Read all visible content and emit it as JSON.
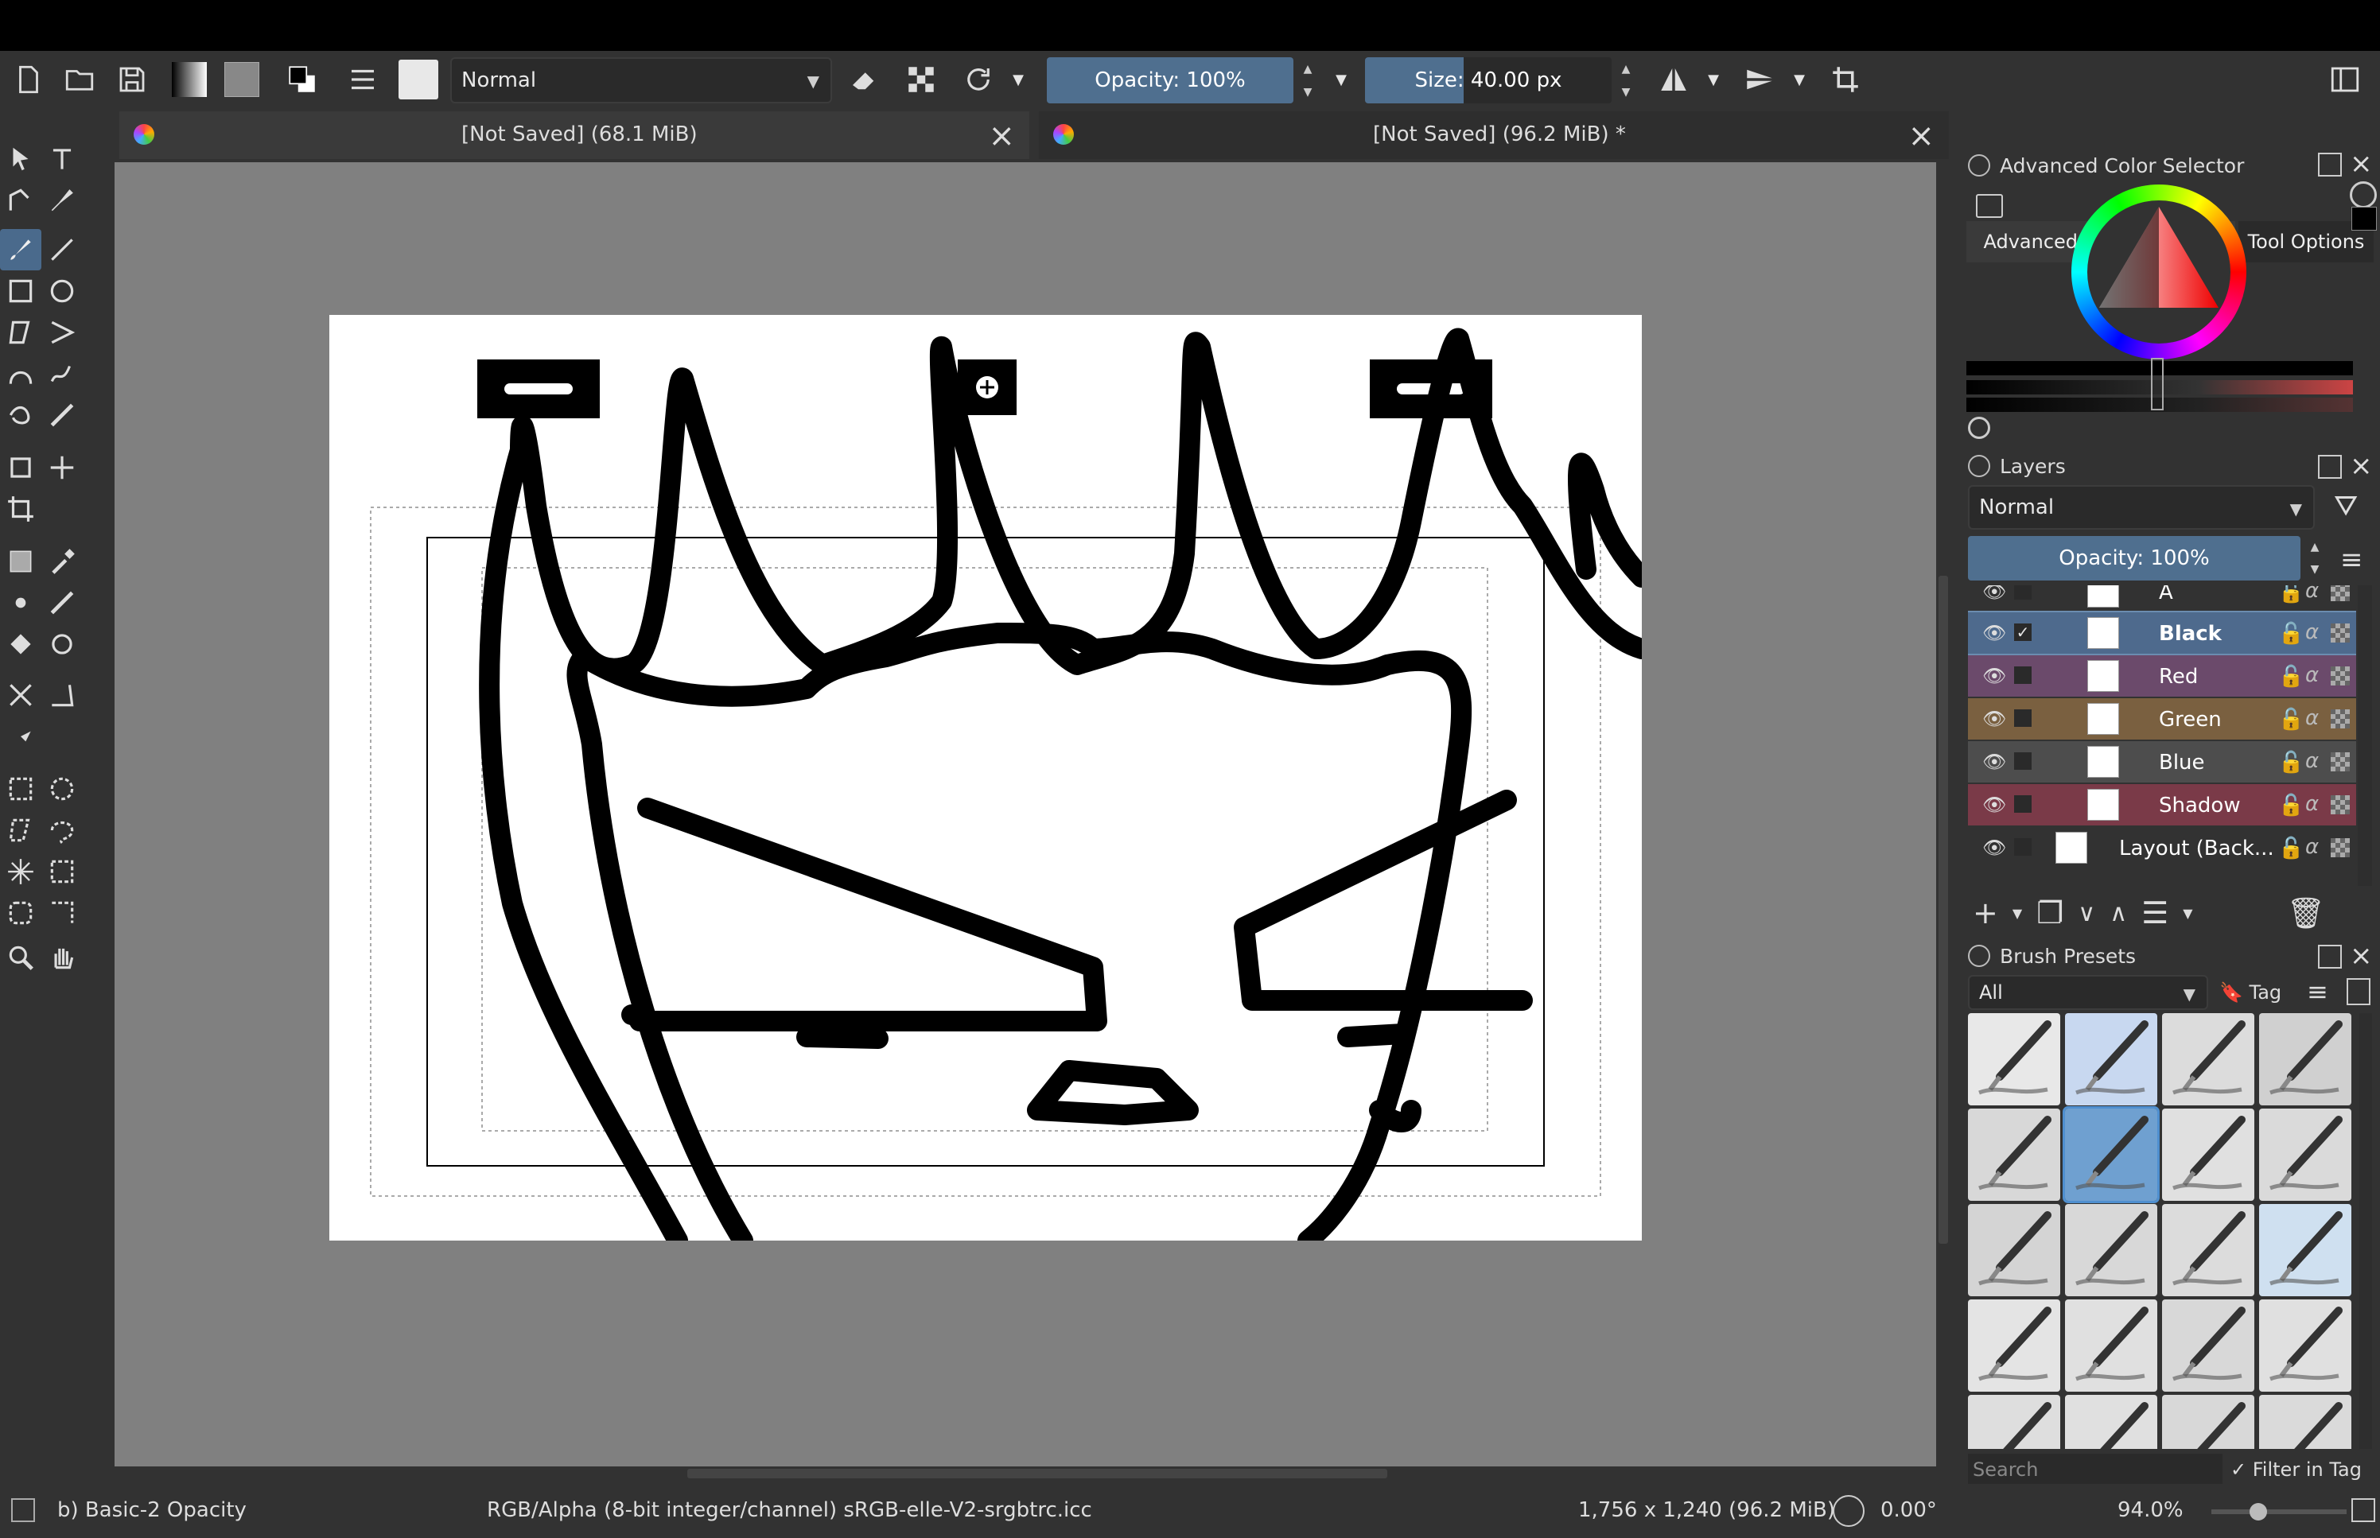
{
  "toolbar": {
    "blend_mode": "Normal",
    "opacity": "Opacity: 100%",
    "opacity_fraction": 1.0,
    "size": "Size: 40.00 px",
    "size_fraction": 0.4
  },
  "tabs": [
    {
      "label": "[Not Saved]  (68.1 MiB)"
    },
    {
      "label": "[Not Saved]  (96.2 MiB) *"
    }
  ],
  "dock": {
    "tab_color": "Advanced Color Selector",
    "tab_options": "Tool Options",
    "color_title": "Advanced Color Selector",
    "layers_title": "Layers",
    "layers_blend": "Normal",
    "layers_opacity": "Opacity: 100%",
    "layers": [
      {
        "name": "A",
        "color": "#323232"
      },
      {
        "name": "Black",
        "color": "#4e6a8d",
        "selected": true
      },
      {
        "name": "Red",
        "color": "#6b4a6b"
      },
      {
        "name": "Green",
        "color": "#7a6040"
      },
      {
        "name": "Blue",
        "color": "#4d4d4d"
      },
      {
        "name": "Shadow",
        "color": "#7a3a48"
      },
      {
        "name": "Layout (Back...",
        "color": "#323232"
      }
    ],
    "brushes_title": "Brush Presets",
    "brush_filter": "All",
    "brush_tag": "Tag",
    "search_placeholder": "Search",
    "filter_in_tag": "Filter in Tag"
  },
  "status": {
    "brush": "b) Basic-2 Opacity",
    "color_info": "RGB/Alpha (8-bit integer/channel)  sRGB-elle-V2-srgbtrc.icc",
    "dims": "1,756 x 1,240 (96.2 MiB)",
    "rotation": "0.00°",
    "zoom": "94.0%"
  }
}
